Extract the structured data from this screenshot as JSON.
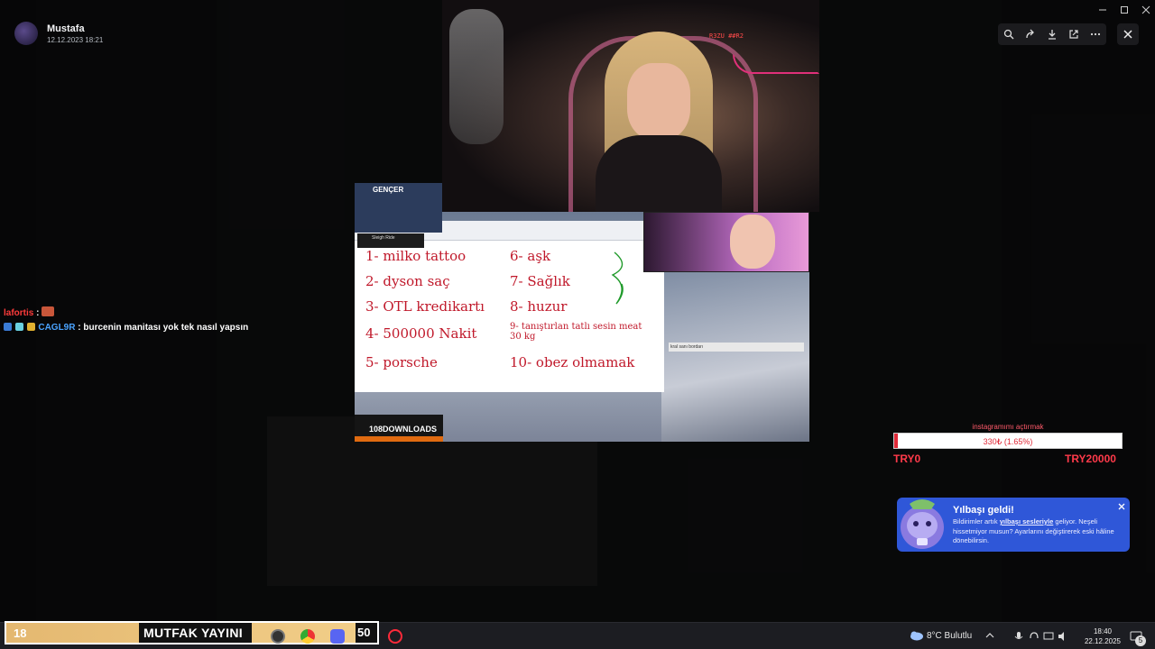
{
  "viewer": {
    "author_name": "Mustafa",
    "author_date": "12.12.2023 18:21"
  },
  "stream": {
    "cam_label": "R3ZU ##R2",
    "gencer_label": "GENÇER",
    "sleigh_title": "Sleigh Ride",
    "downloads_label": "108DOWNLOADS",
    "bridge_label": "kral sanı bordarı"
  },
  "paint_list": [
    "1- milko tattoo",
    "2- dyson saç",
    "3- OTL kredikartı",
    "4- 500000 Nakit",
    "5- porsche",
    "6- aşk",
    "7- Sağlık",
    "8- huzur",
    "9- tanıştırlan tatlı sesin meat 30 kg",
    "10- obez olmamak"
  ],
  "chat": {
    "messages": [
      {
        "user": "lafortis",
        "text": ":",
        "user_color": "#ff3b3b"
      },
      {
        "user": "CAGL9R",
        "text": ": burcenin manitası yok tek nasıl yapsın",
        "user_color": "#4aa3ff"
      }
    ]
  },
  "goal": {
    "title": "instagramımı açtırmak",
    "progress_text": "330₺ (1.65%)",
    "progress_percent": 1.65,
    "min_label": "TRY0",
    "max_label": "TRY20000"
  },
  "notification": {
    "title": "Yılbaşı geldi!",
    "body_before": "Bildirimler artık ",
    "body_link": "yılbaşı sesleriyle",
    "body_after": " geliyor. Neşeli hissetmiyor musun? Ayarlarını değiştirerek eski hâline dönebilirsin."
  },
  "overlay_bar": {
    "left_number": "18",
    "title": "MUTFAK YAYINI",
    "right_number": "50"
  },
  "taskbar": {
    "weather": "8°C  Bulutlu",
    "time": "18:40",
    "date": "22.12.2025",
    "notification_count": "5"
  },
  "colors": {
    "goal_red": "#e02a38",
    "notif_blue": "#2f57d8",
    "overlay_gold": "#f2cf8a"
  }
}
